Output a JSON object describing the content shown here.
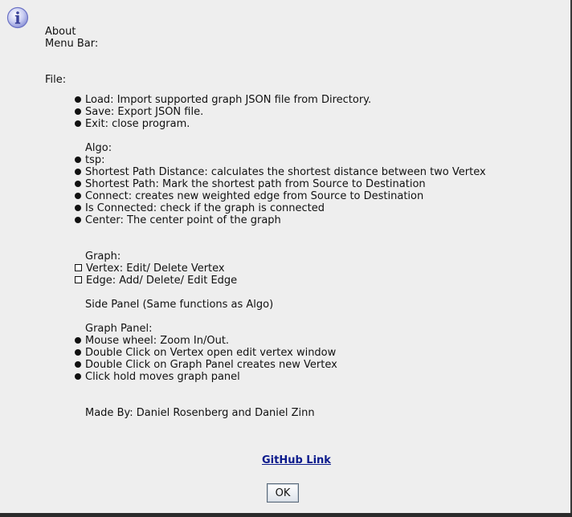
{
  "dialog": {
    "icon": "info-icon",
    "title_lines": [
      "About",
      "Menu Bar:"
    ],
    "file_heading": "File:",
    "file_items": [
      "Load: Import supported graph JSON file from Directory.",
      "Save: Export JSON file.",
      "Exit: close program."
    ],
    "algo_heading": "Algo:",
    "algo_items": [
      "tsp:",
      "Shortest Path Distance: calculates the shortest distance between two Vertex",
      "Shortest Path: Mark the shortest path from Source to Destination",
      "Connect: creates new weighted edge from Source to Destination",
      "Is Connected: check if the graph is connected",
      "Center: The center point of the graph"
    ],
    "graph_heading": "Graph:",
    "graph_items": [
      "Vertex: Edit/ Delete Vertex",
      "Edge: Add/ Delete/ Edit Edge"
    ],
    "side_panel": "Side Panel (Same functions as Algo)",
    "graph_panel_heading": "Graph Panel:",
    "graph_panel_items": [
      "Mouse wheel: Zoom In/Out.",
      "Double Click on Vertex open edit vertex window",
      "Double Click on Graph Panel creates new Vertex",
      "Click hold moves graph panel"
    ],
    "made_by": "Made By: Daniel Rosenberg and Daniel Zinn",
    "github_link": "GitHub Link",
    "ok_label": "OK"
  }
}
